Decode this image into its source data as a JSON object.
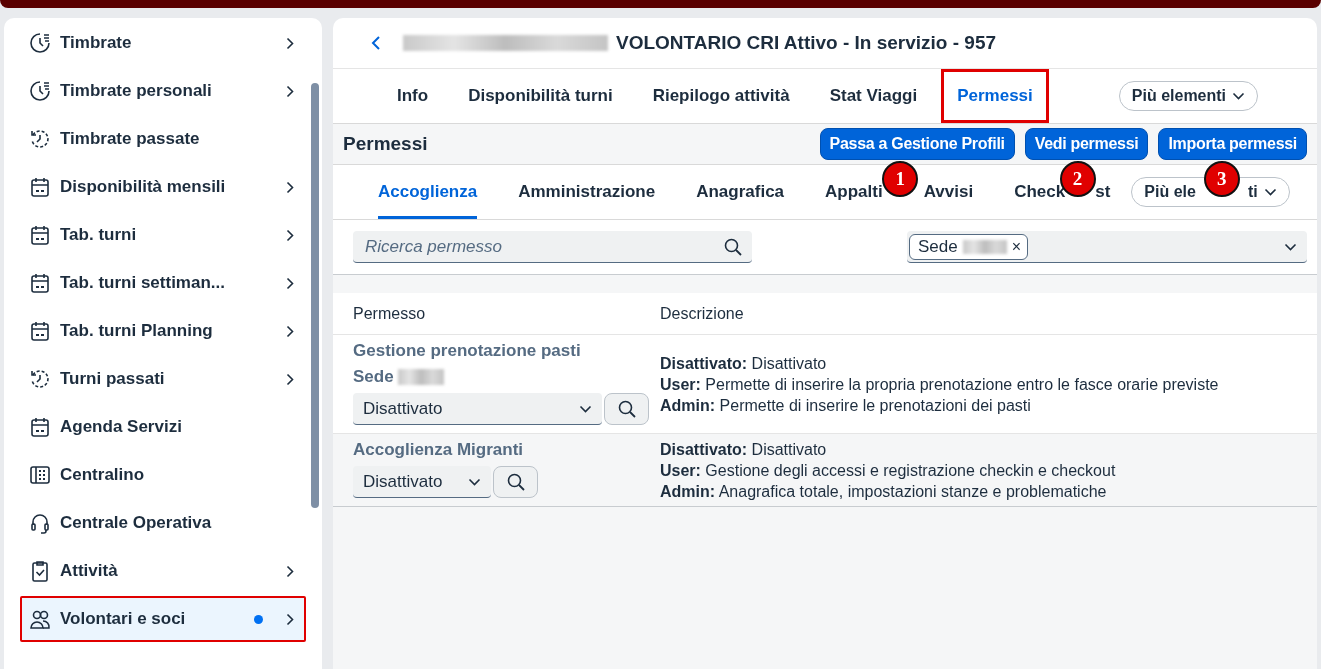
{
  "sidebar": {
    "items": [
      {
        "label": "Timbrate",
        "kind": "clock",
        "submenu": true,
        "selected": false,
        "highlighted": false,
        "dot": false
      },
      {
        "label": "Timbrate personali",
        "kind": "clock",
        "submenu": true,
        "selected": false,
        "highlighted": false,
        "dot": false
      },
      {
        "label": "Timbrate passate",
        "kind": "history",
        "submenu": false,
        "selected": false,
        "highlighted": false,
        "dot": false
      },
      {
        "label": "Disponibilità mensili",
        "kind": "calendar",
        "submenu": true,
        "selected": false,
        "highlighted": false,
        "dot": false
      },
      {
        "label": "Tab. turni",
        "kind": "calendar",
        "submenu": true,
        "selected": false,
        "highlighted": false,
        "dot": false
      },
      {
        "label": "Tab. turni settiman...",
        "kind": "calendar",
        "submenu": true,
        "selected": false,
        "highlighted": false,
        "dot": false
      },
      {
        "label": "Tab. turni Planning",
        "kind": "calendar",
        "submenu": true,
        "selected": false,
        "highlighted": false,
        "dot": false
      },
      {
        "label": "Turni passati",
        "kind": "history",
        "submenu": true,
        "selected": false,
        "highlighted": false,
        "dot": false
      },
      {
        "label": "Agenda Servizi",
        "kind": "calendar",
        "submenu": false,
        "selected": false,
        "highlighted": false,
        "dot": false
      },
      {
        "label": "Centralino",
        "kind": "keypad",
        "submenu": false,
        "selected": false,
        "highlighted": false,
        "dot": false
      },
      {
        "label": "Centrale Operativa",
        "kind": "headset",
        "submenu": false,
        "selected": false,
        "highlighted": false,
        "dot": false
      },
      {
        "label": "Attività",
        "kind": "clipboard",
        "submenu": true,
        "selected": false,
        "highlighted": false,
        "dot": false
      },
      {
        "label": "Volontari e soci",
        "kind": "people",
        "submenu": true,
        "selected": true,
        "highlighted": true,
        "dot": true
      }
    ]
  },
  "header": {
    "title": "VOLONTARIO CRI Attivo - In servizio - 957",
    "redacted_prefix": true
  },
  "tabs": [
    {
      "label": "Info",
      "selected": false,
      "highlighted": false
    },
    {
      "label": "Disponibilità turni",
      "selected": false,
      "highlighted": false
    },
    {
      "label": "Riepilogo attività",
      "selected": false,
      "highlighted": false
    },
    {
      "label": "Stat Viaggi",
      "selected": false,
      "highlighted": false
    },
    {
      "label": "Permessi",
      "selected": true,
      "highlighted": true
    }
  ],
  "tabs_more": "Più elementi",
  "toolbar": {
    "title": "Permessi",
    "buttons": [
      {
        "label": "Passa a Gestione Profili",
        "callout": "1"
      },
      {
        "label": "Vedi permessi",
        "callout": "2"
      },
      {
        "label": "Importa permessi",
        "callout": "3"
      }
    ]
  },
  "subtabs": [
    {
      "label": "Accoglienza",
      "selected": true
    },
    {
      "label": "Amministrazione",
      "selected": false
    },
    {
      "label": "Anagrafica",
      "selected": false
    },
    {
      "label": "Appalti",
      "selected": false
    },
    {
      "label": "Avvisi",
      "selected": false
    },
    {
      "label": "Check",
      "label_end": "st",
      "selected": false
    }
  ],
  "subtabs_more": {
    "label": "Più ele",
    "label_end": "ti"
  },
  "filters": {
    "search": {
      "placeholder": "Ricerca permesso"
    },
    "tokens": [
      {
        "label": "Sede",
        "redacted": true,
        "remove": "×"
      }
    ]
  },
  "table": {
    "columns": [
      "Permesso",
      "Descrizione"
    ],
    "rows": [
      {
        "name": "Gestione prenotazione pasti",
        "subname": "Sede",
        "subname_redacted": true,
        "value": "Disattivato",
        "wide": true,
        "selected": false,
        "description": [
          "**Disattivato:** Disattivato",
          "**User:** Permette di inserire la propria prenotazione entro le fasce orarie previste",
          "**Admin:** Permette di inserire le prenotazioni dei pasti"
        ]
      },
      {
        "name": "Accoglienza Migranti",
        "value": "Disattivato",
        "wide": false,
        "selected": true,
        "description": [
          "**Disattivato:** Disattivato",
          "**User:** Gestione degli accessi e registrazione checkin e checkout",
          "**Admin:** Anagrafica totale, impostazioni stanze e problematiche"
        ]
      }
    ]
  }
}
